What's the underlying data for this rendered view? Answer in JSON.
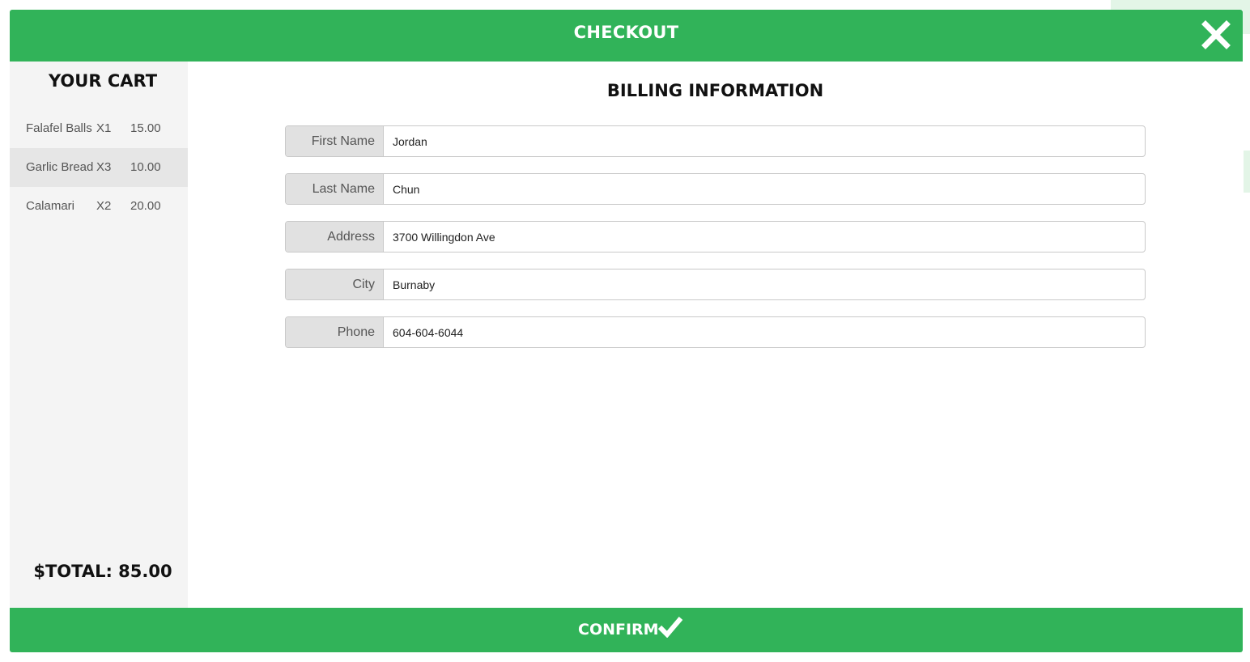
{
  "header": {
    "title": "CHECKOUT",
    "close_icon": "close-icon"
  },
  "cart": {
    "title": "YOUR CART",
    "items": [
      {
        "name": "Falafel Balls",
        "qty": "X1",
        "price": "15.00"
      },
      {
        "name": "Garlic Bread",
        "qty": "X3",
        "price": "10.00"
      },
      {
        "name": "Calamari",
        "qty": "X2",
        "price": "20.00"
      }
    ],
    "total": "$TOTAL: 85.00"
  },
  "billing": {
    "title": "BILLING INFORMATION",
    "fields": [
      {
        "label": "First Name",
        "value": "Jordan"
      },
      {
        "label": "Last Name",
        "value": "Chun"
      },
      {
        "label": "Address",
        "value": "3700 Willingdon Ave"
      },
      {
        "label": "City",
        "value": "Burnaby"
      },
      {
        "label": "Phone",
        "value": "604-604-6044"
      }
    ]
  },
  "footer": {
    "confirm_label": "CONFIRM",
    "confirm_icon": "checkmark-icon"
  },
  "colors": {
    "accent": "#31b359",
    "sidebar_bg": "#f4f4f4",
    "label_bg": "#e1e1e1"
  }
}
